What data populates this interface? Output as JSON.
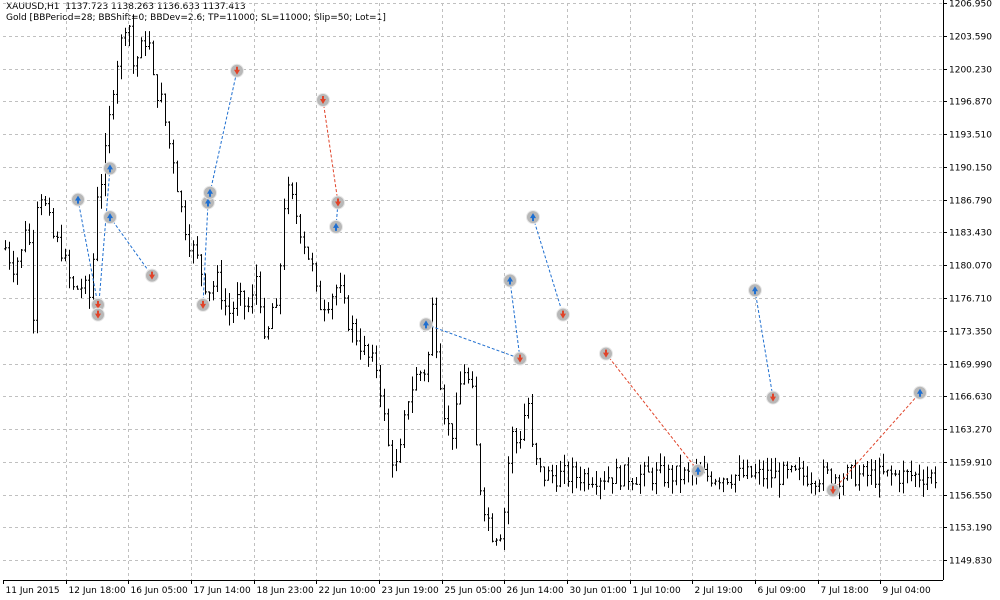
{
  "header": {
    "symbol": "XAUUSD,H1",
    "ohlc": "1137.723 1138.263 1136.633 1137.413",
    "params": "Gold [BBPeriod=28; BBShift=0; BBDev=2.6; TP=11000; SL=11000; Slip=50; Lot=1]"
  },
  "colors": {
    "background": "#ffffff",
    "grid": "#c0c0c0",
    "bars": "#000000",
    "buy_marker": "#1f6fd0",
    "sell_marker": "#e0442a",
    "buy_line": "#1f6fd0",
    "sell_line": "#e0442a",
    "marker_halo": "#b8b8b8"
  },
  "chart_data": {
    "type": "ohlc",
    "ylim": [
      1147.8,
      1206.95
    ],
    "y_ticks": [
      "1206.950",
      "1203.590",
      "1200.230",
      "1196.870",
      "1193.510",
      "1190.150",
      "1186.790",
      "1183.430",
      "1180.070",
      "1176.710",
      "1173.350",
      "1169.990",
      "1166.630",
      "1163.270",
      "1159.910",
      "1156.550",
      "1153.190",
      "1149.830"
    ],
    "x_ticks": [
      "11 Jun 2015",
      "12 Jun 18:00",
      "16 Jun 05:00",
      "17 Jun 14:00",
      "18 Jun 23:00",
      "22 Jun 10:00",
      "23 Jun 19:00",
      "25 Jun 05:00",
      "26 Jun 14:00",
      "30 Jun 01:00",
      "1 Jul 10:00",
      "2 Jul 19:00",
      "6 Jul 09:00",
      "7 Jul 18:00",
      "9 Jul 04:00"
    ],
    "bar_count": 234,
    "grid": true,
    "price_path": [
      [
        0,
        1182.5
      ],
      [
        10,
        1180.0
      ],
      [
        20,
        1181.5
      ],
      [
        25,
        1187.0
      ],
      [
        28,
        1177.5
      ],
      [
        31,
        1175.0
      ],
      [
        35,
        1188.5
      ],
      [
        40,
        1187.0
      ],
      [
        50,
        1183.0
      ],
      [
        60,
        1181.5
      ],
      [
        65,
        1179.0
      ],
      [
        70,
        1177.5
      ],
      [
        80,
        1178.0
      ],
      [
        88,
        1176.5
      ],
      [
        95,
        1188.5
      ],
      [
        100,
        1189.0
      ],
      [
        112,
        1200.0
      ],
      [
        120,
        1203.5
      ],
      [
        125,
        1206.5
      ],
      [
        130,
        1200.5
      ],
      [
        140,
        1202.5
      ],
      [
        145,
        1204.0
      ],
      [
        150,
        1199.0
      ],
      [
        160,
        1196.5
      ],
      [
        165,
        1193.0
      ],
      [
        170,
        1191.5
      ],
      [
        178,
        1186.0
      ],
      [
        185,
        1183.0
      ],
      [
        195,
        1180.5
      ],
      [
        205,
        1177.5
      ],
      [
        215,
        1178.5
      ],
      [
        225,
        1175.0
      ],
      [
        235,
        1176.5
      ],
      [
        248,
        1175.5
      ],
      [
        255,
        1180.0
      ],
      [
        262,
        1171.0
      ],
      [
        270,
        1176.0
      ],
      [
        275,
        1174.5
      ],
      [
        280,
        1186.0
      ],
      [
        285,
        1187.5
      ],
      [
        290,
        1186.5
      ],
      [
        300,
        1183.0
      ],
      [
        310,
        1179.5
      ],
      [
        315,
        1176.0
      ],
      [
        325,
        1176.5
      ],
      [
        335,
        1178.0
      ],
      [
        345,
        1174.5
      ],
      [
        355,
        1172.5
      ],
      [
        365,
        1170.5
      ],
      [
        375,
        1169.5
      ],
      [
        385,
        1161.5
      ],
      [
        395,
        1159.0
      ],
      [
        405,
        1166.5
      ],
      [
        415,
        1169.0
      ],
      [
        425,
        1169.5
      ],
      [
        428,
        1177.0
      ],
      [
        435,
        1171.0
      ],
      [
        440,
        1166.0
      ],
      [
        445,
        1163.5
      ],
      [
        450,
        1163.0
      ],
      [
        455,
        1165.5
      ],
      [
        460,
        1170.0
      ],
      [
        470,
        1166.5
      ],
      [
        475,
        1159.0
      ],
      [
        480,
        1156.0
      ],
      [
        490,
        1152.5
      ],
      [
        500,
        1153.0
      ],
      [
        505,
        1159.5
      ],
      [
        510,
        1163.0
      ],
      [
        515,
        1161.5
      ],
      [
        525,
        1166.5
      ],
      [
        530,
        1160.5
      ],
      [
        539,
        1158.5
      ]
    ],
    "trades": [
      {
        "dir": "buy",
        "open": [
          78,
          1186.79
        ],
        "close": [
          98,
          1176.0
        ]
      },
      {
        "dir": "buy",
        "open": [
          110,
          1190.0
        ],
        "close": [
          98,
          1175.0
        ]
      },
      {
        "dir": "buy",
        "open": [
          110,
          1185.0
        ],
        "close": [
          152,
          1179.0
        ]
      },
      {
        "dir": "buy",
        "open": [
          208,
          1186.5
        ],
        "close": [
          203,
          1176.0
        ]
      },
      {
        "dir": "buy",
        "open": [
          210,
          1187.5
        ],
        "close": [
          237,
          1200.0
        ]
      },
      {
        "dir": "sell",
        "open": [
          323,
          1197.0
        ],
        "close": [
          338,
          1186.5
        ]
      },
      {
        "dir": "buy",
        "open": [
          336,
          1184.0
        ],
        "close": [
          338,
          1186.5
        ]
      },
      {
        "dir": "buy",
        "open": [
          426,
          1174.0
        ],
        "close": [
          520,
          1170.5
        ]
      },
      {
        "dir": "buy",
        "open": [
          510,
          1178.5
        ],
        "close": [
          520,
          1170.5
        ]
      },
      {
        "dir": "buy",
        "open": [
          533,
          1185.0
        ],
        "close": [
          563,
          1175.0
        ]
      },
      {
        "dir": "sell",
        "open": [
          606,
          1171.0
        ],
        "close": [
          698,
          1159.0
        ]
      },
      {
        "dir": "buy",
        "open": [
          755,
          1177.5
        ],
        "close": [
          773,
          1166.5
        ]
      },
      {
        "dir": "sell",
        "open": [
          833,
          1157.0
        ],
        "close": [
          920,
          1167.0
        ]
      }
    ]
  }
}
